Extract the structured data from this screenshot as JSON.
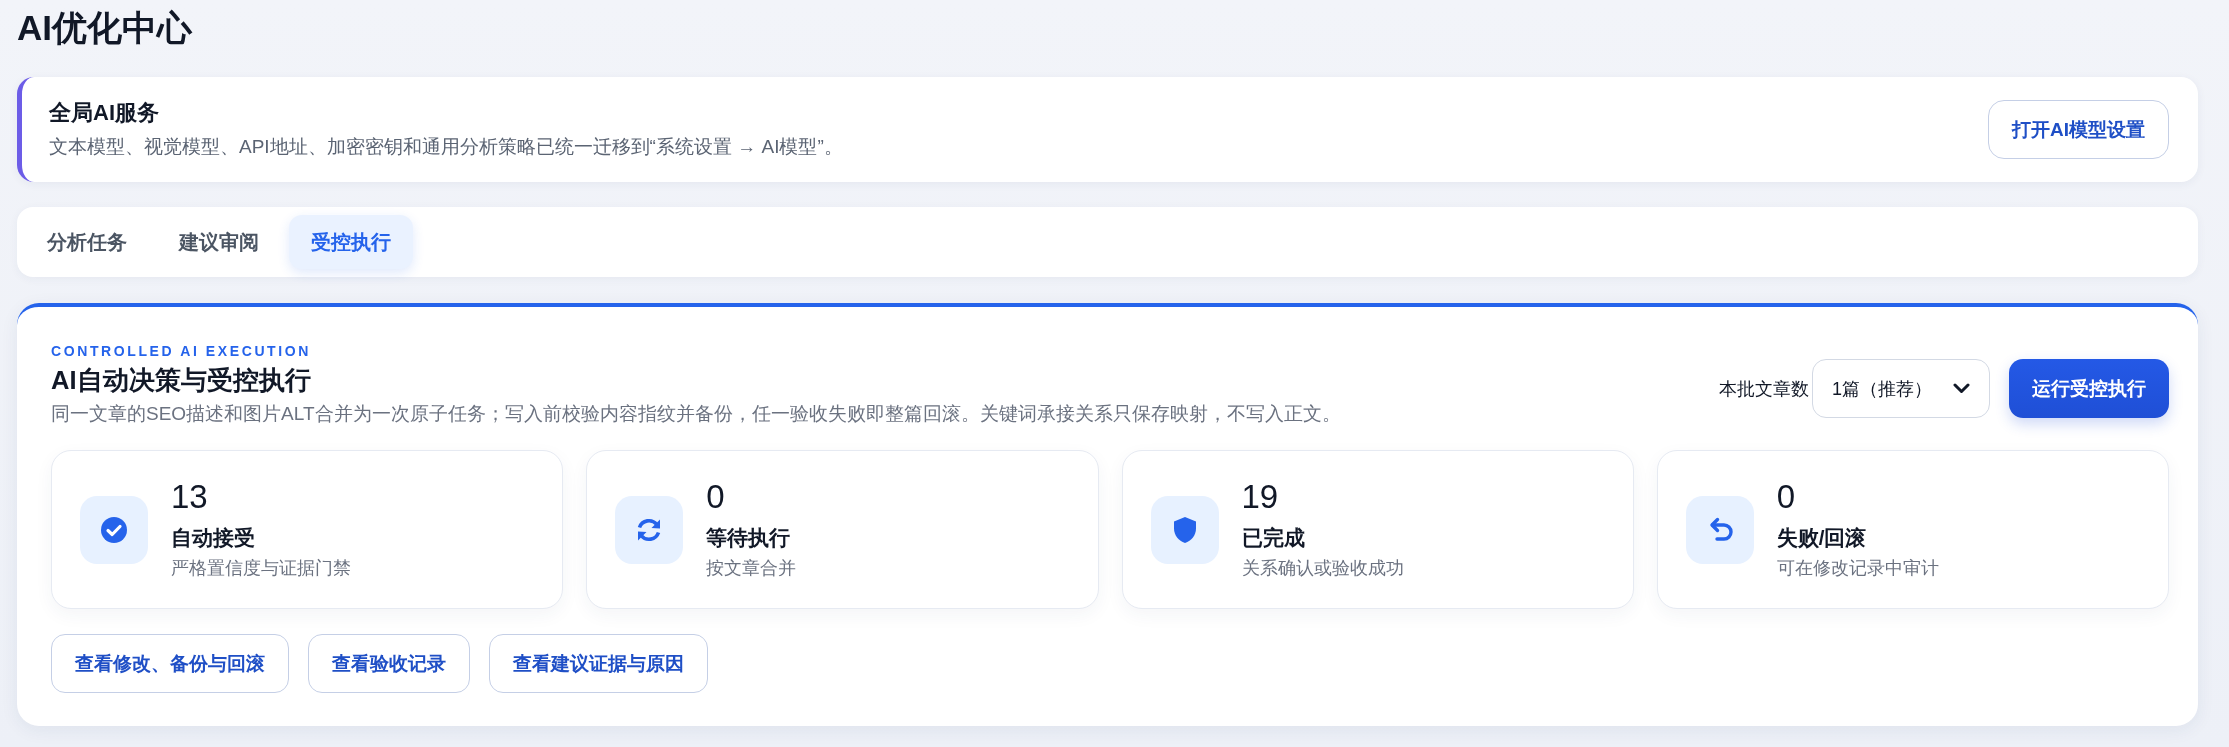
{
  "page": {
    "title": "AI优化中心"
  },
  "global_ai_card": {
    "title": "全局AI服务",
    "description": "文本模型、视觉模型、API地址、加密密钥和通用分析策略已统一迁移到“系统设置 → AI模型”。",
    "button": "打开AI模型设置"
  },
  "tabs": [
    {
      "label": "分析任务",
      "selected": false
    },
    {
      "label": "建议审阅",
      "selected": false
    },
    {
      "label": "受控执行",
      "selected": true
    }
  ],
  "execution_panel": {
    "eyebrow": "CONTROLLED AI EXECUTION",
    "title": "AI自动决策与受控执行",
    "description": "同一文章的SEO描述和图片ALT合并为一次原子任务；写入前校验内容指纹并备份，任一验收失败即整篇回滚。关键词承接关系只保存映射，不写入正文。",
    "batch_label": "本批文章数",
    "batch_select": {
      "value": "1篇（推荐）"
    },
    "run_button": "运行受控执行",
    "stats": [
      {
        "kind": "accepted",
        "value": "13",
        "label": "自动接受",
        "caption": "严格置信度与证据门禁"
      },
      {
        "kind": "pending",
        "value": "0",
        "label": "等待执行",
        "caption": "按文章合并"
      },
      {
        "kind": "completed",
        "value": "19",
        "label": "已完成",
        "caption": "关系确认或验收成功"
      },
      {
        "kind": "failed",
        "value": "0",
        "label": "失败/回滚",
        "caption": "可在修改记录中审计"
      }
    ],
    "actions": [
      "查看修改、备份与回滚",
      "查看验收记录",
      "查看建议证据与原因"
    ]
  }
}
